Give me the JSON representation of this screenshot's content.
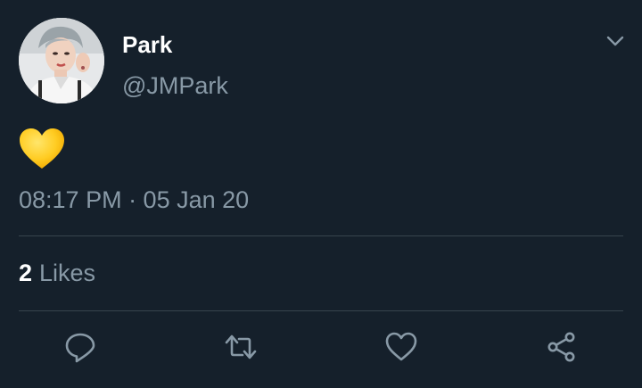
{
  "author": {
    "display_name": "Park",
    "handle": "@JMPark"
  },
  "tweet": {
    "content_icon": "yellow-heart-emoji",
    "timestamp": "08:17 PM · 05 Jan 20"
  },
  "stats": {
    "likes_count": "2",
    "likes_label": "Likes"
  },
  "actions": [
    {
      "icon": "reply-icon"
    },
    {
      "icon": "retweet-icon"
    },
    {
      "icon": "like-icon"
    },
    {
      "icon": "share-icon"
    }
  ],
  "colors": {
    "background": "#15202b",
    "secondary_text": "#8899a6",
    "divider": "#38444d",
    "emoji_yellow": "#ffcc22"
  }
}
